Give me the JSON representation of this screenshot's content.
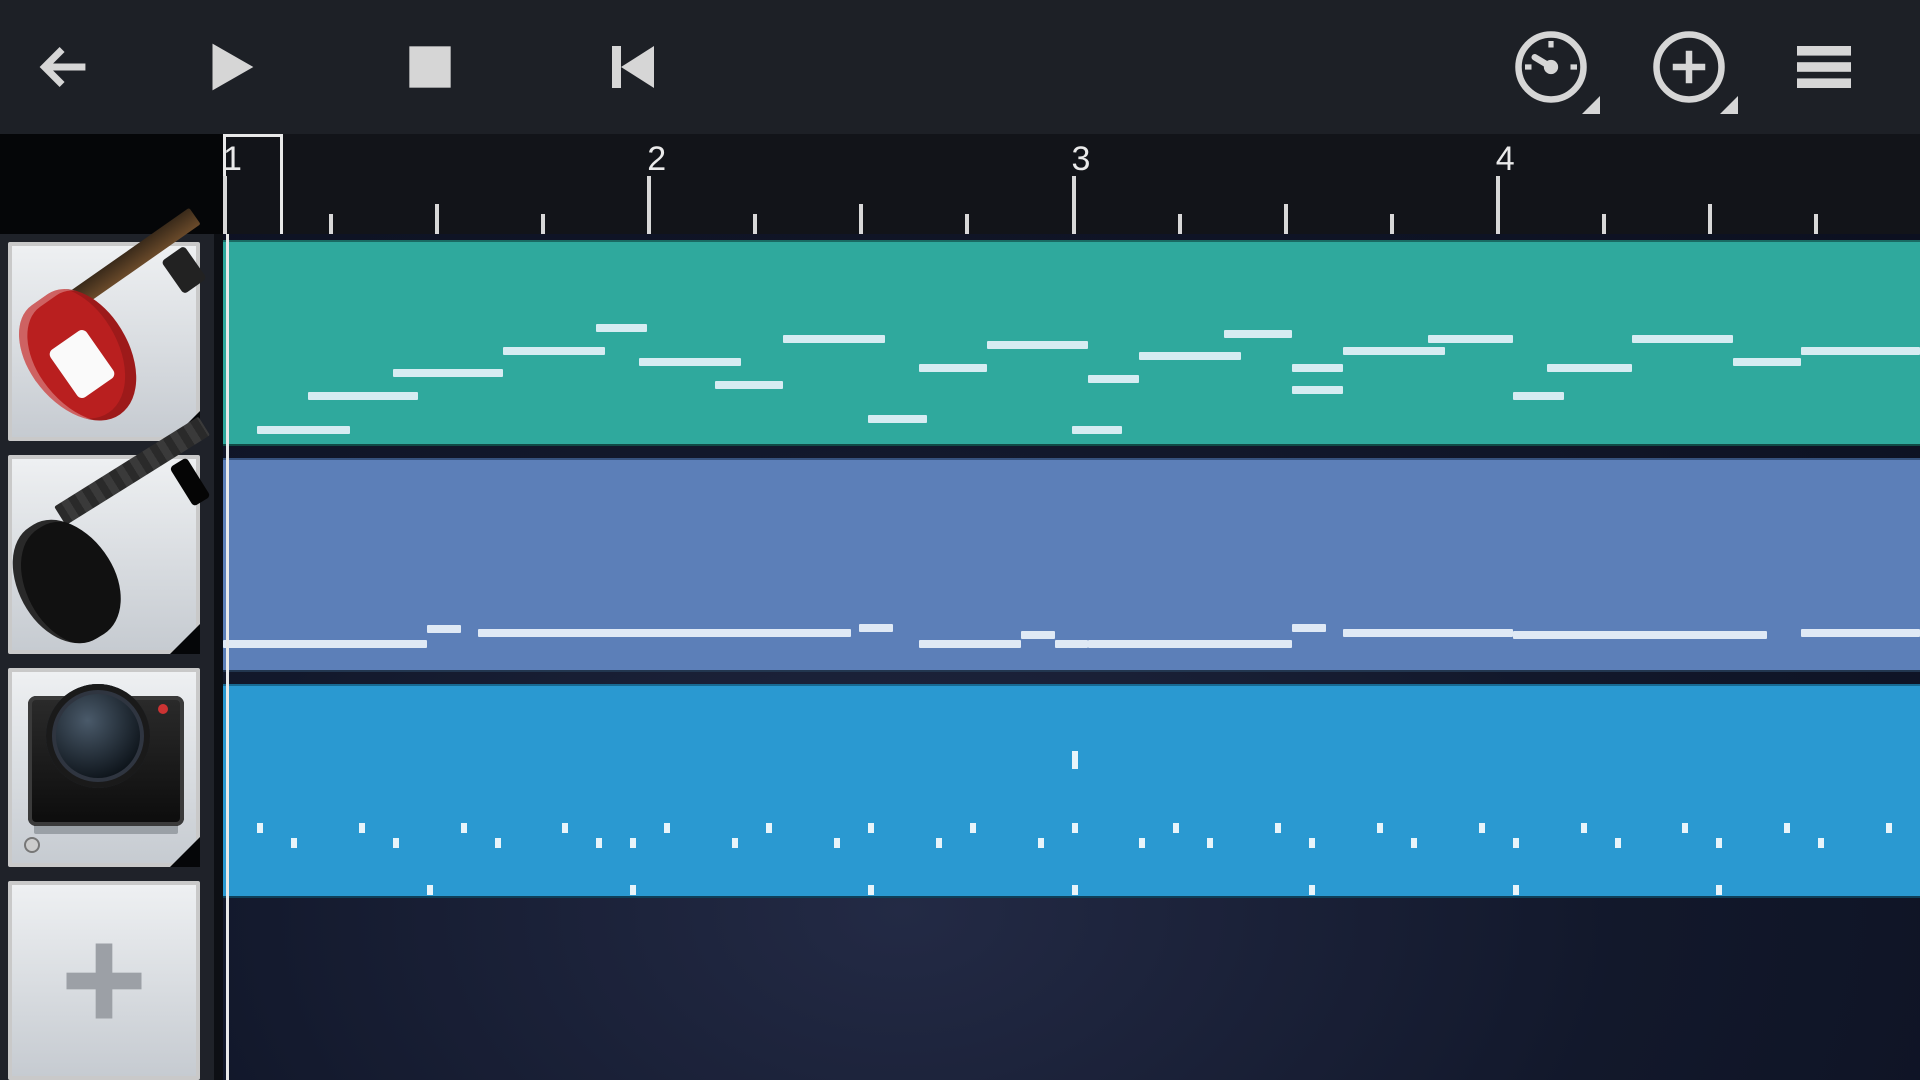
{
  "toolbar": {
    "back": "Back",
    "play": "Play",
    "stop": "Stop",
    "rewind": "Go to Start",
    "tempo": "Tempo / Metronome",
    "add": "Add",
    "menu": "Menu"
  },
  "ruler": {
    "bars": [
      1,
      2,
      3,
      4
    ],
    "subdivisions_per_bar": 4,
    "playhead_bar": 1
  },
  "instruments": [
    {
      "id": "electric-guitar",
      "label": "Electric Guitar",
      "color": "#2fa99d"
    },
    {
      "id": "bass-guitar",
      "label": "Bass Guitar",
      "color": "#5c7fb8"
    },
    {
      "id": "drum-machine",
      "label": "Drum Machine",
      "color": "#2a99d1"
    }
  ],
  "add_track_label": "Add Track",
  "tracks": {
    "guitar_notes": [
      {
        "start": 2,
        "len": 5.5,
        "pitch": 0
      },
      {
        "start": 5,
        "len": 6.5,
        "pitch": 30
      },
      {
        "start": 10,
        "len": 6.5,
        "pitch": 50
      },
      {
        "start": 16.5,
        "len": 6,
        "pitch": 70
      },
      {
        "start": 22,
        "len": 3,
        "pitch": 90
      },
      {
        "start": 24.5,
        "len": 6,
        "pitch": 60
      },
      {
        "start": 29,
        "len": 4,
        "pitch": 40
      },
      {
        "start": 33,
        "len": 6,
        "pitch": 80
      },
      {
        "start": 38,
        "len": 3.5,
        "pitch": 10
      },
      {
        "start": 41,
        "len": 4,
        "pitch": 55
      },
      {
        "start": 45,
        "len": 6,
        "pitch": 75
      },
      {
        "start": 50,
        "len": 3,
        "pitch": 0
      },
      {
        "start": 51,
        "len": 3,
        "pitch": 45
      },
      {
        "start": 54,
        "len": 6,
        "pitch": 65
      },
      {
        "start": 59,
        "len": 4,
        "pitch": 85
      },
      {
        "start": 63,
        "len": 3,
        "pitch": 35
      },
      {
        "start": 63,
        "len": 3,
        "pitch": 55
      },
      {
        "start": 66,
        "len": 6,
        "pitch": 70
      },
      {
        "start": 71,
        "len": 5,
        "pitch": 80
      },
      {
        "start": 76,
        "len": 3,
        "pitch": 30
      },
      {
        "start": 78,
        "len": 5,
        "pitch": 55
      },
      {
        "start": 83,
        "len": 6,
        "pitch": 80
      },
      {
        "start": 89,
        "len": 4,
        "pitch": 60
      },
      {
        "start": 93,
        "len": 7,
        "pitch": 70
      }
    ],
    "bass_notes": [
      {
        "start": 0,
        "len": 12,
        "pitch": 0
      },
      {
        "start": 12,
        "len": 2,
        "pitch": 20
      },
      {
        "start": 15,
        "len": 22,
        "pitch": 15
      },
      {
        "start": 37.5,
        "len": 2,
        "pitch": 22
      },
      {
        "start": 41,
        "len": 6,
        "pitch": 0
      },
      {
        "start": 47,
        "len": 2,
        "pitch": 12
      },
      {
        "start": 49,
        "len": 2,
        "pitch": 0
      },
      {
        "start": 51,
        "len": 12,
        "pitch": 0
      },
      {
        "start": 63,
        "len": 2,
        "pitch": 22
      },
      {
        "start": 66,
        "len": 10,
        "pitch": 15
      },
      {
        "start": 76,
        "len": 15,
        "pitch": 12
      },
      {
        "start": 93,
        "len": 7,
        "pitch": 15
      }
    ],
    "drum_hits": {
      "row_high_pct": 36,
      "row_mid_pct": 67,
      "row_midlow_pct": 74,
      "row_low_pct": 96,
      "high": [
        50
      ],
      "mid": [
        2,
        8,
        14,
        20,
        26,
        32,
        38,
        44,
        50,
        56,
        62,
        68,
        74,
        80,
        86,
        92,
        98
      ],
      "midlow": [
        4,
        10,
        16,
        22,
        24,
        30,
        36,
        42,
        48,
        54,
        58,
        64,
        70,
        76,
        82,
        88,
        94
      ],
      "low": [
        12,
        24,
        38,
        50,
        64,
        76,
        88
      ]
    }
  }
}
